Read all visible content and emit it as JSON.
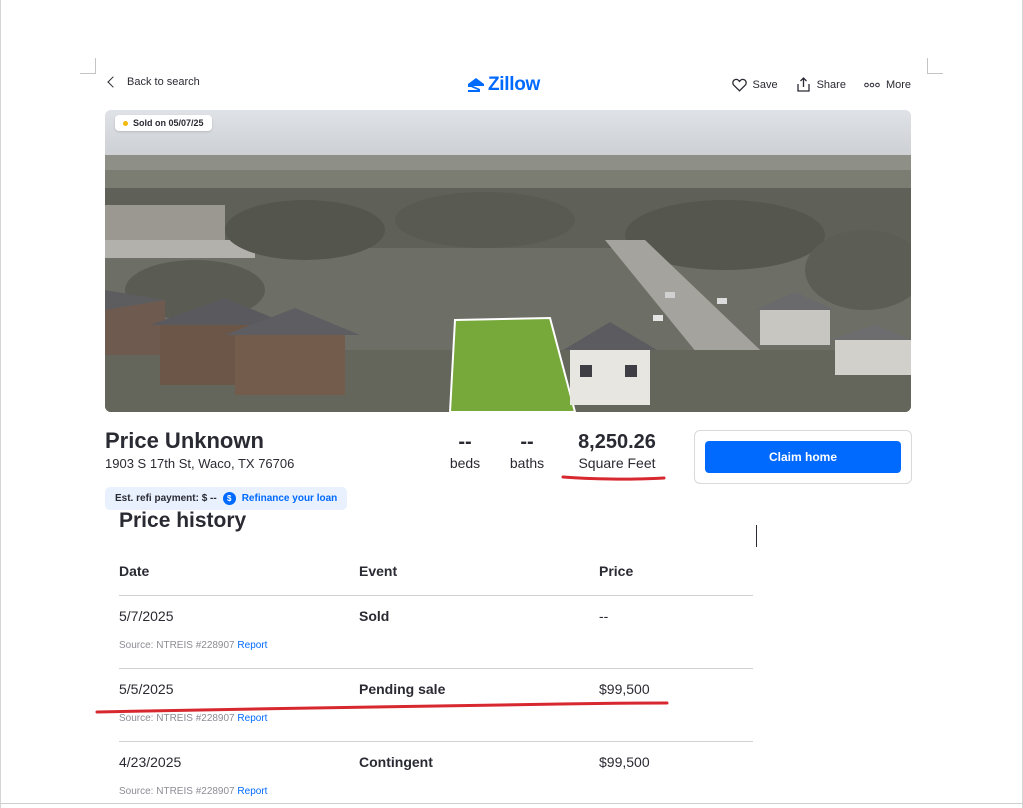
{
  "topbar": {
    "back_label": "Back to search",
    "logo_text": "Zillow",
    "save_label": "Save",
    "share_label": "Share",
    "more_label": "More"
  },
  "hero": {
    "sold_badge": "Sold on 05/07/25"
  },
  "summary": {
    "price": "Price Unknown",
    "address": "1903 S 17th St, Waco, TX 76706",
    "beds_value": "--",
    "beds_label": "beds",
    "baths_value": "--",
    "baths_label": "baths",
    "sqft_value": "8,250.26",
    "sqft_label": "Square Feet"
  },
  "claim": {
    "button_label": "Claim home"
  },
  "refi": {
    "label": "Est. refi payment: $ --",
    "icon_glyph": "$",
    "link": "Refinance your loan"
  },
  "price_history": {
    "title": "Price history",
    "headers": {
      "date": "Date",
      "event": "Event",
      "price": "Price"
    },
    "rows": [
      {
        "date": "5/7/2025",
        "event": "Sold",
        "price": "--",
        "source": "Source: NTREIS #228907",
        "report": "Report"
      },
      {
        "date": "5/5/2025",
        "event": "Pending sale",
        "price": "$99,500",
        "source": "Source: NTREIS #228907",
        "report": "Report"
      },
      {
        "date": "4/23/2025",
        "event": "Contingent",
        "price": "$99,500",
        "source": "Source: NTREIS #228907",
        "report": "Report"
      }
    ]
  },
  "colors": {
    "brand_blue": "#006aff",
    "text_dark": "#2a2a33",
    "annotation_red": "#d7282f"
  },
  "icons": [
    "chevron-left-icon",
    "zillow-house-icon",
    "heart-icon",
    "share-icon",
    "more-dots-icon",
    "dollar-icon"
  ]
}
